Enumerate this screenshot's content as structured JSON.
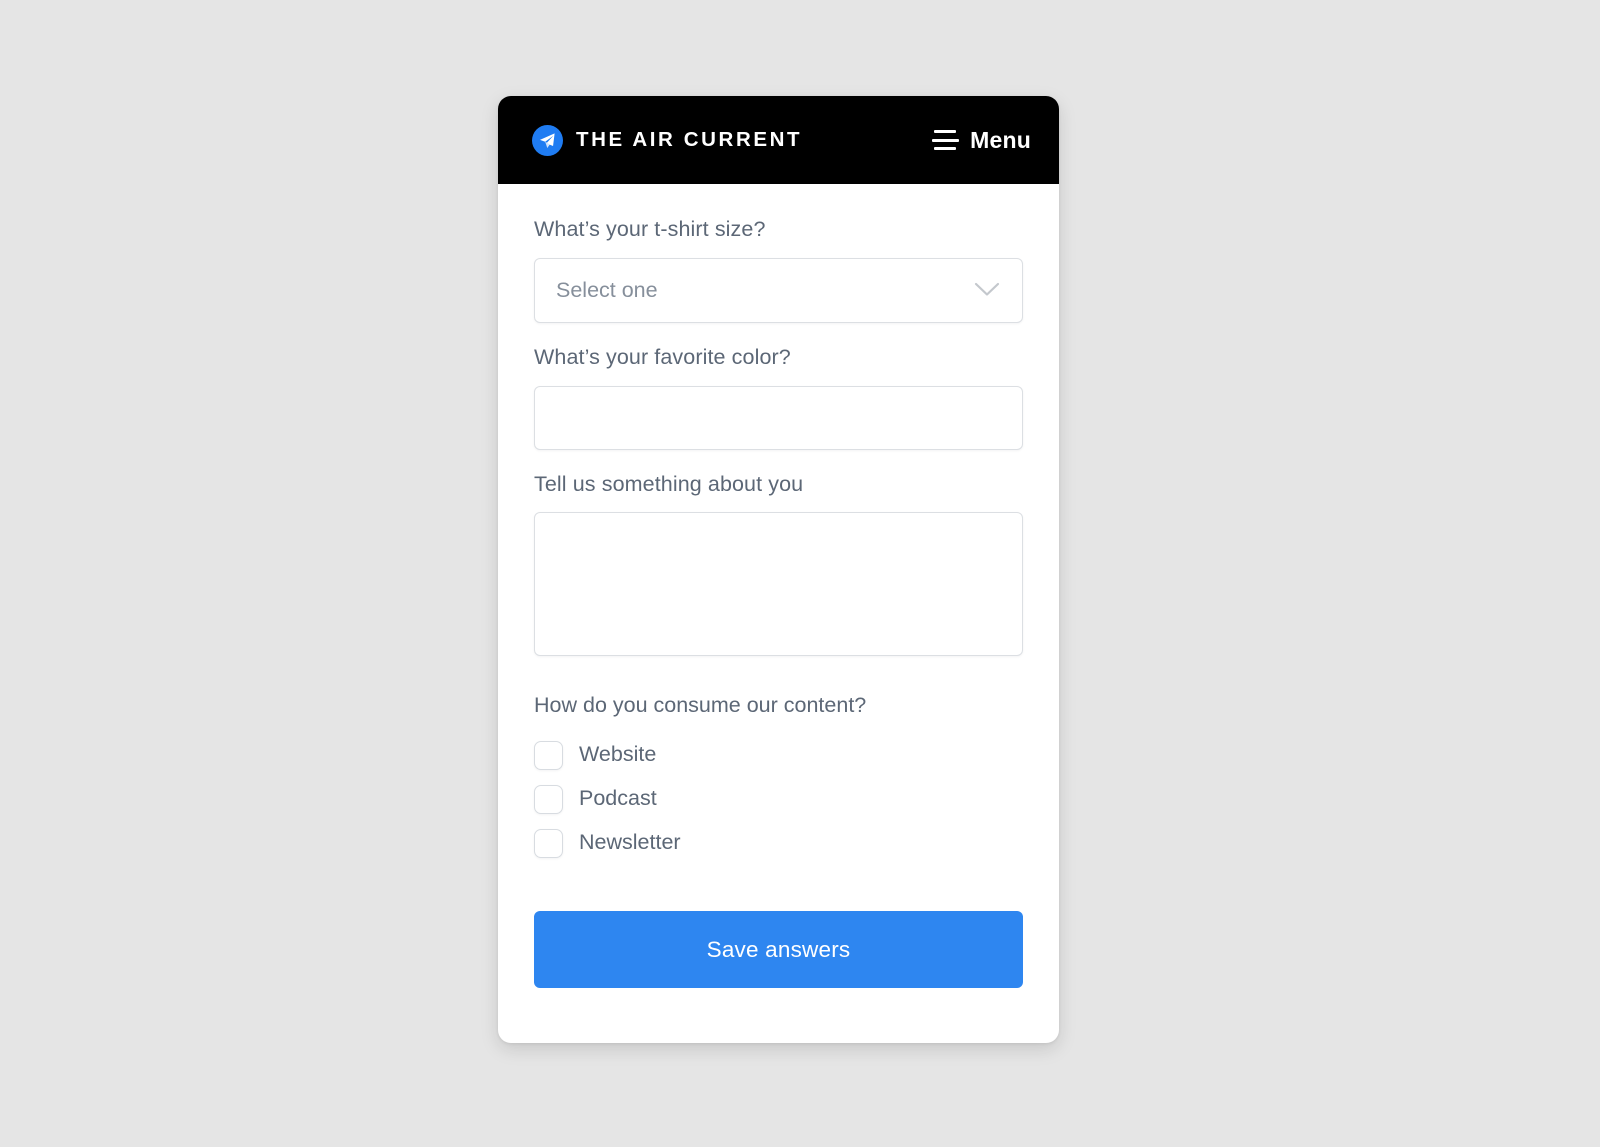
{
  "colors": {
    "page_background": "#e5e5e5",
    "header_background": "#000000",
    "brand_blue": "#1f7cf2",
    "button_blue": "#2e86f0",
    "label_text": "#5c6776",
    "placeholder_text": "#868f9b",
    "border": "#dcdfe3"
  },
  "header": {
    "logo_icon": "paper-plane-icon",
    "brand_name": "THE AIR CURRENT",
    "menu_icon": "hamburger-menu-icon",
    "menu_label": "Menu"
  },
  "form": {
    "tshirt": {
      "label": "What’s your t-shirt size?",
      "selected_value": "Select one",
      "chevron_icon": "chevron-down-icon"
    },
    "color": {
      "label": "What’s your favorite color?",
      "value": "",
      "placeholder": ""
    },
    "about": {
      "label": "Tell us something about you",
      "value": "",
      "placeholder": ""
    },
    "consume": {
      "label": "How do you consume our content?",
      "options": [
        {
          "label": "Website",
          "checked": false
        },
        {
          "label": "Podcast",
          "checked": false
        },
        {
          "label": "Newsletter",
          "checked": false
        }
      ]
    },
    "submit_label": "Save answers"
  }
}
